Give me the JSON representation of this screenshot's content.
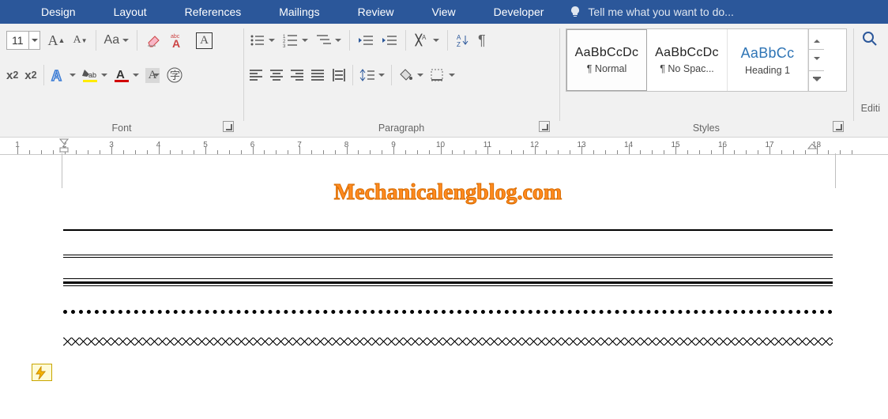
{
  "tabs": [
    "Design",
    "Layout",
    "References",
    "Mailings",
    "Review",
    "View",
    "Developer"
  ],
  "tellme": "Tell me what you want to do...",
  "font": {
    "size_value": "11",
    "group_label": "Font"
  },
  "paragraph": {
    "group_label": "Paragraph"
  },
  "styles": {
    "group_label": "Styles",
    "items": [
      {
        "sample": "AaBbCcDc",
        "name": "¶ Normal"
      },
      {
        "sample": "AaBbCcDc",
        "name": "¶ No Spac..."
      },
      {
        "sample": "AaBbCc",
        "name": "Heading 1"
      }
    ]
  },
  "editing": {
    "label": "Editi"
  },
  "ruler": {
    "start": 1,
    "end": 18
  },
  "doc": {
    "watermark": "Mechanicalengblog.com"
  }
}
